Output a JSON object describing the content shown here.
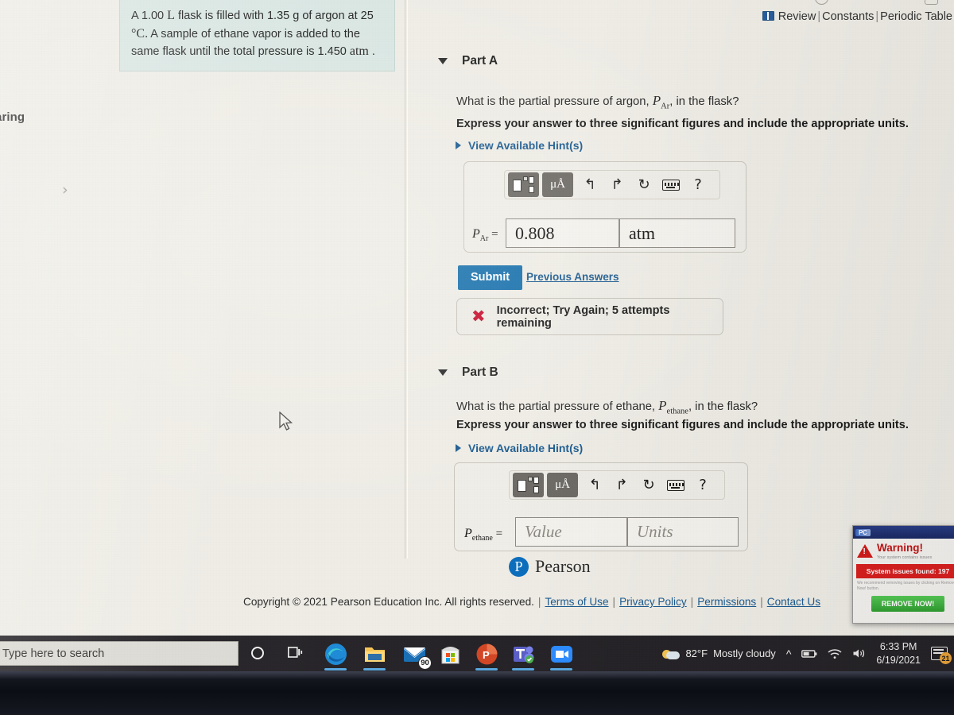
{
  "header": {
    "review_label": "Review",
    "constants_label": "Constants",
    "periodic_table_label": "Periodic Table",
    "separator": "|",
    "book_icon": "book-icon"
  },
  "left_panel": {
    "truncated_label": "aring",
    "expand_chevron": "›"
  },
  "problem": {
    "line1_a": "A 1.00 ",
    "line1_unit": "L",
    "line1_b": " flask is filled with 1.35 g of argon at 25",
    "line2_deg": "°C.",
    "line2_b": " A sample of ethane vapor is added to the same",
    "line3_a": "flask until the total pressure is 1.450 ",
    "line3_unit": "atm",
    "line3_b": " ."
  },
  "part_a": {
    "title": "Part A",
    "caret": "collapse-caret",
    "question_pre": "What is the partial pressure of argon, ",
    "question_var": "P",
    "question_sub": "Ar",
    "question_post": ", in the flask?",
    "instruction": "Express your answer to three significant figures and include the appropriate units.",
    "hint_label": "View Available Hint(s)",
    "toolbar": {
      "template_icon": "math-template-icon",
      "units_icon": "mu-angstrom-icon",
      "units_label": "μÅ",
      "undo_icon": "undo-arrow-icon",
      "undo_glyph": "↰",
      "redo_icon": "redo-arrow-icon",
      "redo_glyph": "↱",
      "reset_icon": "reset-circular-arrow-icon",
      "reset_glyph": "↻",
      "keyboard_icon": "keyboard-icon",
      "help_icon": "help-question-icon",
      "help_glyph": "?"
    },
    "eq_var": "P",
    "eq_sub": "Ar",
    "eq_equals": "=",
    "value": "0.808",
    "units": "atm",
    "submit_label": "Submit",
    "previous_answers_label": "Previous Answers",
    "feedback_icon": "red-x-icon",
    "feedback_glyph": "✖",
    "feedback_text": "Incorrect; Try Again; 5 attempts remaining"
  },
  "part_b": {
    "title": "Part B",
    "caret": "collapse-caret",
    "question_pre": "What is the partial pressure of ethane, ",
    "question_var": "P",
    "question_sub": "ethane",
    "question_post": ", in the flask?",
    "instruction": "Express your answer to three significant figures and include the appropriate units.",
    "hint_label": "View Available Hint(s)",
    "toolbar": {
      "template_icon": "math-template-icon",
      "units_label": "μÅ",
      "undo_glyph": "↰",
      "redo_glyph": "↱",
      "reset_glyph": "↻",
      "help_glyph": "?"
    },
    "eq_var": "P",
    "eq_sub": "ethane",
    "eq_equals": "=",
    "value_placeholder": "Value",
    "units_placeholder": "Units"
  },
  "footer": {
    "logo_letter": "P",
    "logo_word": "Pearson",
    "copyright": "Copyright © 2021 Pearson Education Inc. All rights reserved.",
    "bar": "|",
    "terms_label": "Terms of Use",
    "privacy_label": "Privacy Policy",
    "permissions_label": "Permissions",
    "contact_label": "Contact Us"
  },
  "ad_popup": {
    "brand": "PC",
    "warning_title": "Warning!",
    "warning_sub": "Your system contains issues",
    "issues_banner": "System issues found: 197",
    "description": "We recommend removing issues by clicking on Remove Now! button.",
    "remove_label": "REMOVE NOW!"
  },
  "taskbar": {
    "search_placeholder": "Type here to search",
    "cortana_icon": "cortana-circle-icon",
    "taskview_icon": "task-view-icon",
    "apps": [
      {
        "name": "edge-icon",
        "badge": ""
      },
      {
        "name": "file-explorer-icon",
        "badge": ""
      },
      {
        "name": "mail-icon",
        "badge": "90"
      },
      {
        "name": "microsoft-store-icon",
        "badge": ""
      },
      {
        "name": "powerpoint-icon",
        "badge": ""
      },
      {
        "name": "microsoft-teams-icon",
        "badge": ""
      },
      {
        "name": "zoom-icon",
        "badge": ""
      }
    ],
    "weather_temp": "82°F",
    "weather_desc": "Mostly cloudy",
    "chevron_glyph": "^",
    "tray_icons": [
      "battery-icon",
      "wifi-icon",
      "volume-icon"
    ],
    "time": "6:33 PM",
    "date": "6/19/2021",
    "action_center_icon": "action-center-icon",
    "action_center_badge": "21"
  },
  "colors": {
    "accent_blue": "#1a72ad",
    "link_blue": "#1d5c91",
    "error_red": "#c8102e",
    "problem_box_bg": "#d9e6e2",
    "page_bg": "#eeece5"
  }
}
